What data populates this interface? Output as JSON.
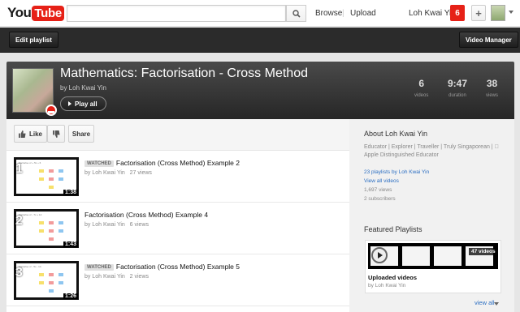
{
  "topbar": {
    "logo_you": "You",
    "logo_tube": "Tube",
    "search_placeholder": "",
    "browse": "Browse",
    "separator": "|",
    "upload": "Upload",
    "username": "Loh Kwai Yin",
    "notifications": "6",
    "plus": "+"
  },
  "darkbar": {
    "edit_playlist": "Edit playlist",
    "video_manager": "Video Manager"
  },
  "playlist": {
    "title": "Mathematics: Factorisation - Cross Method",
    "byline": "by Loh Kwai Yin",
    "play_all": "Play all",
    "stats": {
      "videos_value": "6",
      "videos_label": "videos",
      "duration_value": "9:47",
      "duration_label": "duration",
      "views_value": "38",
      "views_label": "views"
    }
  },
  "actions": {
    "like": "Like",
    "share": "Share"
  },
  "videos": [
    {
      "index": "1",
      "watched": "WATCHED",
      "title": "Factorisation (Cross Method) Example 2",
      "by": "by Loh Kwai Yin",
      "views": "27 views",
      "duration": "1:38",
      "caption": "Factorise x² + 5x + 6"
    },
    {
      "index": "2",
      "watched": "",
      "title": "Factorisation (Cross Method) Example 4",
      "by": "by Loh Kwai Yin",
      "views": "6 views",
      "duration": "1:43",
      "caption": "Factorise x² - 7x + 12"
    },
    {
      "index": "3",
      "watched": "WATCHED",
      "title": "Factorisation (Cross Method) Example 5",
      "by": "by Loh Kwai Yin",
      "views": "2 views",
      "duration": "1:26",
      "caption": "Factorise x² - 5x - 14"
    }
  ],
  "sidebar": {
    "about_title": "About Loh Kwai Yin",
    "about_desc": "Educator | Explorer | Traveller | Truly Singaporean |  Apple Distinguished Educator",
    "playlists_link": "23 playlists by Loh Kwai Yin",
    "view_all_videos": "View all videos",
    "views": "1,697 views",
    "subscribers": "2 subscribers",
    "featured_title": "Featured Playlists",
    "featured_count": "47 videos",
    "featured_name": "Uploaded videos",
    "featured_by": "by Loh Kwai Yin",
    "view_all": "view all"
  },
  "colors": {
    "brand_red": "#e62117",
    "link_blue": "#2b6ec2",
    "header_dark": "#262626"
  }
}
